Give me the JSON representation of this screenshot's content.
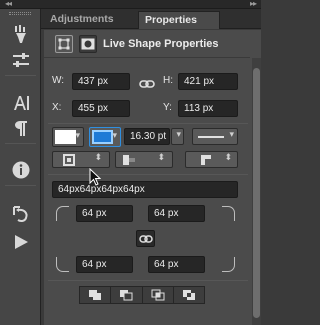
{
  "tabs": [
    {
      "label": "Adjustments",
      "active": false
    },
    {
      "label": "Properties",
      "active": true
    }
  ],
  "toolbar": {
    "icons": [
      "brush-preset-icon",
      "adjustments-sliders-icon",
      "character-icon",
      "paragraph-icon",
      "info-icon",
      "history-icon",
      "actions-play-icon"
    ]
  },
  "properties": {
    "title": "Live Shape Properties",
    "w_label": "W:",
    "w_value": "437 px",
    "h_label": "H:",
    "h_value": "421 px",
    "x_label": "X:",
    "x_value": "455 px",
    "y_label": "Y:",
    "y_value": "113 px",
    "stroke_width": "16.30 pt",
    "corner_radii": "64px64px64px64px",
    "corner_tl": "64 px",
    "corner_tr": "64 px",
    "corner_bl": "64 px",
    "corner_br": "64 px"
  },
  "colors": {
    "fill": "#ffffff",
    "stroke": "#1e7ad6",
    "accent": "#2f8fe0"
  }
}
